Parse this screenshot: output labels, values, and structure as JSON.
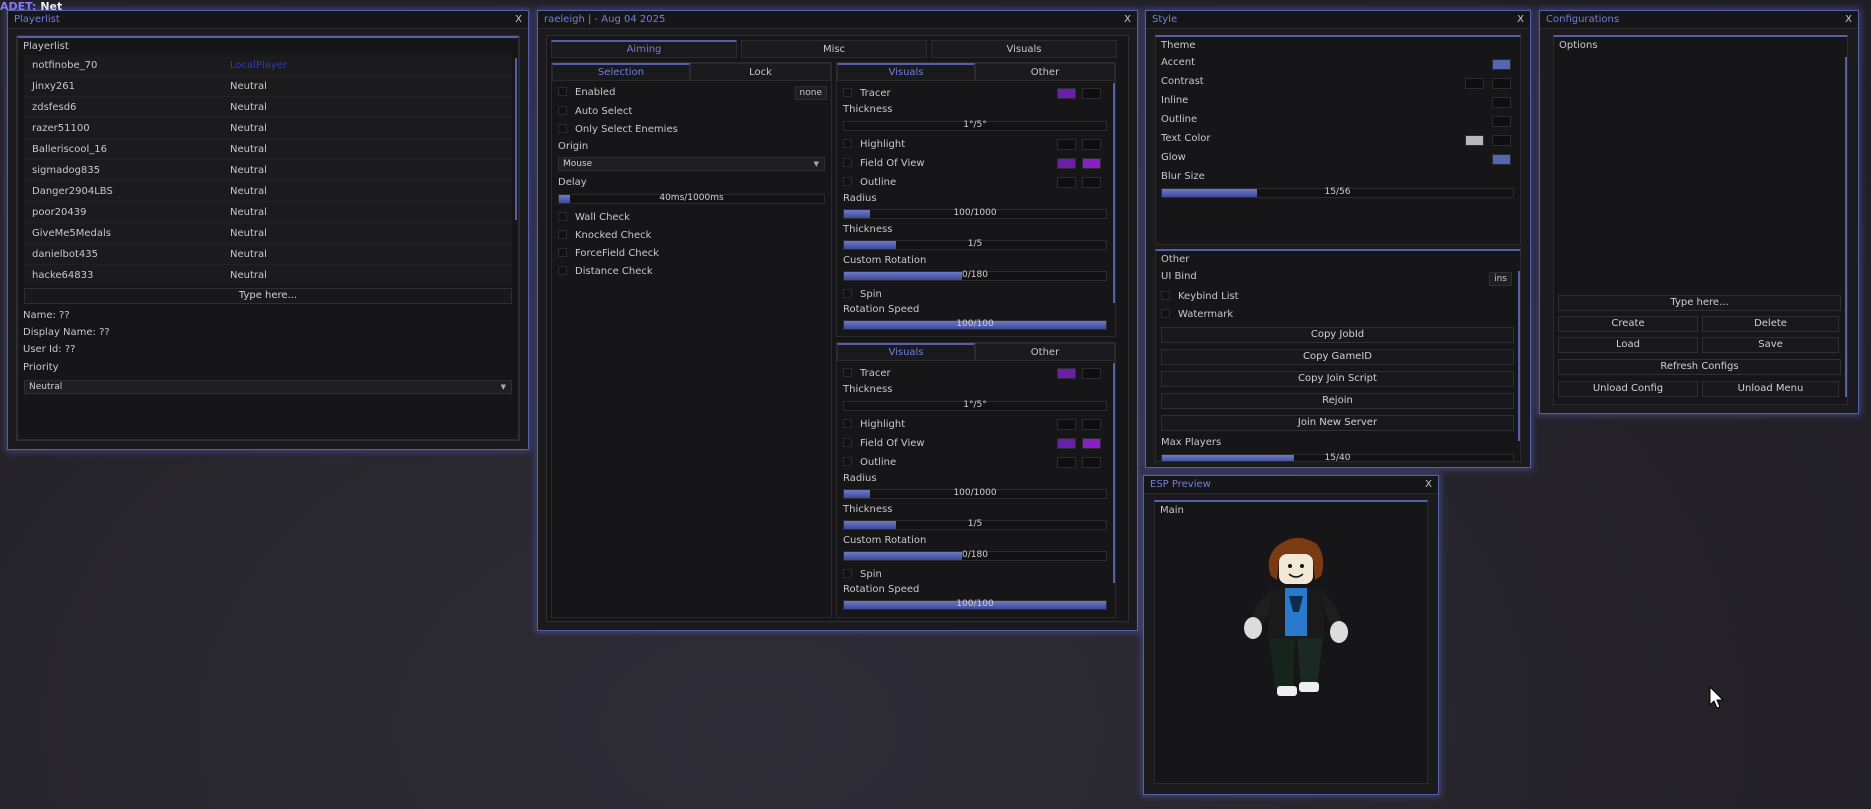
{
  "corner": {
    "prefix": "ADET:",
    "suffix": "Net"
  },
  "playerlist": {
    "title": "Playerlist",
    "close": "X",
    "group_label": "Playerlist",
    "players": [
      {
        "name": "notfinobe_70",
        "status": "LocalPlayer"
      },
      {
        "name": "Jinxy261",
        "status": "Neutral"
      },
      {
        "name": "zdsfesd6",
        "status": "Neutral"
      },
      {
        "name": "razer51100",
        "status": "Neutral"
      },
      {
        "name": "Balleriscool_16",
        "status": "Neutral"
      },
      {
        "name": "sigmadog835",
        "status": "Neutral"
      },
      {
        "name": "Danger2904LBS",
        "status": "Neutral"
      },
      {
        "name": "poor20439",
        "status": "Neutral"
      },
      {
        "name": "GiveMe5Medals",
        "status": "Neutral"
      },
      {
        "name": "danielbot435",
        "status": "Neutral"
      },
      {
        "name": "hacke64833",
        "status": "Neutral"
      }
    ],
    "search_placeholder": "Type here...",
    "name_line": "Name: ??",
    "display_line": "Display Name: ??",
    "userid_line": "User Id: ??",
    "priority_label": "Priority",
    "priority_value": "Neutral"
  },
  "main": {
    "title": "raeleigh |  - Aug 04 2025",
    "close": "X",
    "tabs": [
      "Aiming",
      "Misc",
      "Visuals"
    ],
    "left_tabs": [
      "Selection",
      "Lock"
    ],
    "enabled_label": "Enabled",
    "enabled_key": "none",
    "auto_select": "Auto Select",
    "only_enemies": "Only Select Enemies",
    "origin_label": "Origin",
    "origin_value": "Mouse",
    "delay_label": "Delay",
    "delay_value": "40ms/1000ms",
    "delay_fill": 0.04,
    "checks": [
      "Wall Check",
      "Knocked Check",
      "ForceField Check",
      "Distance Check"
    ],
    "panels": [
      {
        "tabs": [
          "Visuals",
          "Other"
        ],
        "tracer": "Tracer",
        "thickness_label": "Thickness",
        "thickness_value": "1°/5°",
        "highlight": "Highlight",
        "fov": "Field Of View",
        "outline": "Outline",
        "radius_label": "Radius",
        "radius_value": "100/1000",
        "radius_fill": 0.1,
        "thickness2_label": "Thickness",
        "thickness2_value": "1/5",
        "thickness2_fill": 0.2,
        "rotation_label": "Custom Rotation",
        "rotation_value": "0/180",
        "rotation_fill": 0.45,
        "spin": "Spin",
        "speed_label": "Rotation Speed",
        "speed_value": "100/100",
        "speed_fill": 1.0
      },
      {
        "tabs": [
          "Visuals",
          "Other"
        ],
        "tracer": "Tracer",
        "thickness_label": "Thickness",
        "thickness_value": "1°/5°",
        "highlight": "Highlight",
        "fov": "Field Of View",
        "outline": "Outline",
        "radius_label": "Radius",
        "radius_value": "100/1000",
        "radius_fill": 0.1,
        "thickness2_label": "Thickness",
        "thickness2_value": "1/5",
        "thickness2_fill": 0.2,
        "rotation_label": "Custom Rotation",
        "rotation_value": "0/180",
        "rotation_fill": 0.45,
        "spin": "Spin",
        "speed_label": "Rotation Speed",
        "speed_value": "100/100",
        "speed_fill": 1.0
      }
    ]
  },
  "style": {
    "title": "Style",
    "close": "X",
    "theme_label": "Theme",
    "accent": "Accent",
    "contrast": "Contrast",
    "inline": "Inline",
    "outline": "Outline",
    "text_color": "Text Color",
    "glow": "Glow",
    "blur_label": "Blur Size",
    "blur_value": "15/56",
    "blur_fill": 0.27,
    "other_label": "Other",
    "ui_bind": "UI Bind",
    "ui_bind_key": "ins",
    "keybind_list": "Keybind List",
    "watermark": "Watermark",
    "buttons": [
      "Copy JobId",
      "Copy GameID",
      "Copy Join Script",
      "Rejoin",
      "Join New Server"
    ],
    "max_players": "Max Players",
    "max_value": "15/40",
    "max_fill": 0.375,
    "colors": {
      "accent": "#5566b0",
      "purple": "#6a1fa8",
      "purple2": "#8a1fc8",
      "dark": "#0e0e10",
      "light": "#b8b8b8"
    }
  },
  "configs": {
    "title": "Configurations",
    "close": "X",
    "options_label": "Options",
    "input_placeholder": "Type here...",
    "create": "Create",
    "delete": "Delete",
    "load": "Load",
    "save": "Save",
    "refresh": "Refresh Configs",
    "unload_config": "Unload Config",
    "unload_menu": "Unload Menu"
  },
  "esp": {
    "title": "ESP Preview",
    "close": "X",
    "main_label": "Main"
  }
}
